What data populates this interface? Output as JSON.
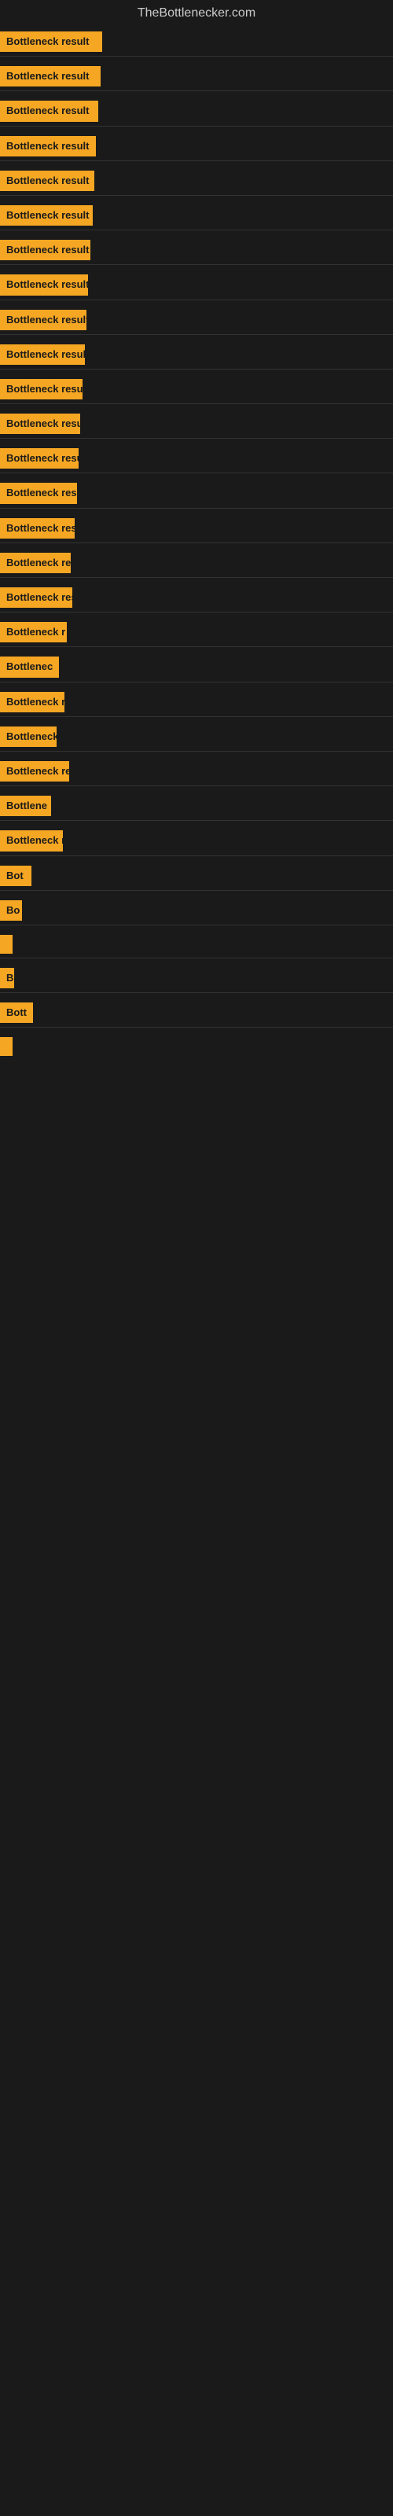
{
  "site": {
    "title": "TheBottlenecker.com"
  },
  "bars": [
    {
      "id": 1,
      "label": "Bottleneck result",
      "width": 130
    },
    {
      "id": 2,
      "label": "Bottleneck result",
      "width": 128
    },
    {
      "id": 3,
      "label": "Bottleneck result",
      "width": 125
    },
    {
      "id": 4,
      "label": "Bottleneck result",
      "width": 122
    },
    {
      "id": 5,
      "label": "Bottleneck result",
      "width": 120
    },
    {
      "id": 6,
      "label": "Bottleneck result",
      "width": 118
    },
    {
      "id": 7,
      "label": "Bottleneck result",
      "width": 115
    },
    {
      "id": 8,
      "label": "Bottleneck result",
      "width": 112
    },
    {
      "id": 9,
      "label": "Bottleneck result",
      "width": 110
    },
    {
      "id": 10,
      "label": "Bottleneck result",
      "width": 108
    },
    {
      "id": 11,
      "label": "Bottleneck result",
      "width": 105
    },
    {
      "id": 12,
      "label": "Bottleneck result",
      "width": 102
    },
    {
      "id": 13,
      "label": "Bottleneck result",
      "width": 100
    },
    {
      "id": 14,
      "label": "Bottleneck result",
      "width": 98
    },
    {
      "id": 15,
      "label": "Bottleneck result",
      "width": 95
    },
    {
      "id": 16,
      "label": "Bottleneck re",
      "width": 90
    },
    {
      "id": 17,
      "label": "Bottleneck result",
      "width": 92
    },
    {
      "id": 18,
      "label": "Bottleneck r",
      "width": 85
    },
    {
      "id": 19,
      "label": "Bottlenec",
      "width": 75
    },
    {
      "id": 20,
      "label": "Bottleneck r",
      "width": 82
    },
    {
      "id": 21,
      "label": "Bottleneck",
      "width": 72
    },
    {
      "id": 22,
      "label": "Bottleneck res",
      "width": 88
    },
    {
      "id": 23,
      "label": "Bottlene",
      "width": 65
    },
    {
      "id": 24,
      "label": "Bottleneck r",
      "width": 80
    },
    {
      "id": 25,
      "label": "Bot",
      "width": 40
    },
    {
      "id": 26,
      "label": "Bo",
      "width": 28
    },
    {
      "id": 27,
      "label": "",
      "width": 8
    },
    {
      "id": 28,
      "label": "B",
      "width": 18
    },
    {
      "id": 29,
      "label": "Bott",
      "width": 42
    },
    {
      "id": 30,
      "label": "",
      "width": 5
    }
  ]
}
